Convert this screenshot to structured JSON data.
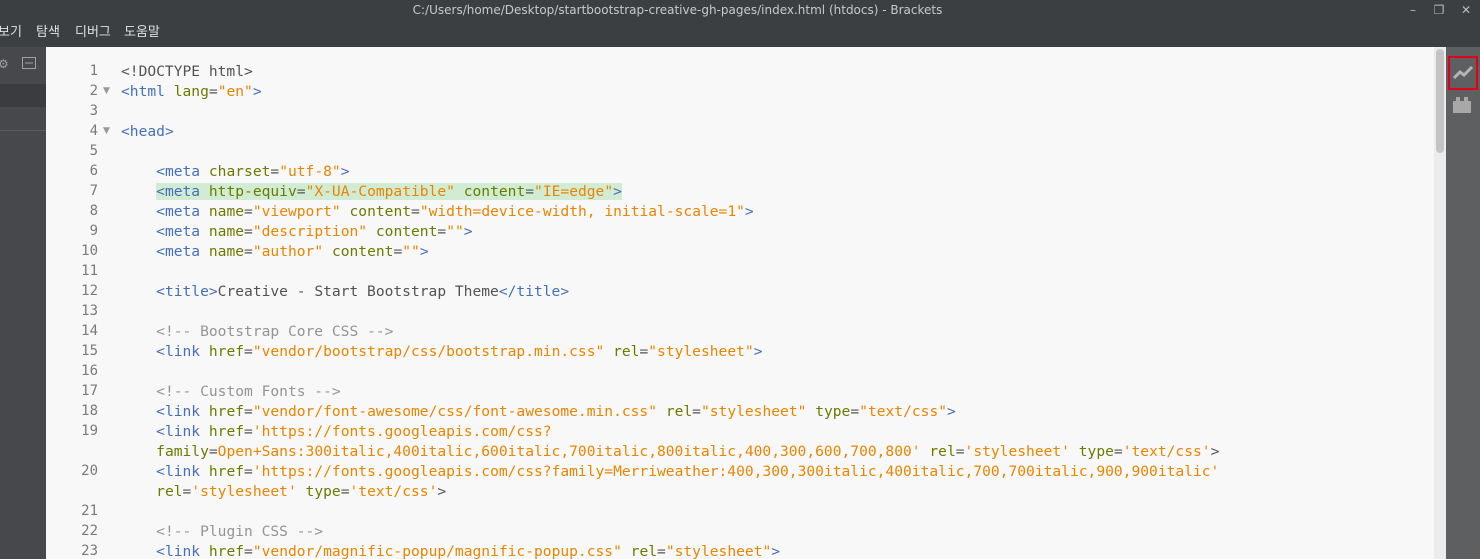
{
  "window": {
    "title": "C:/Users/home/Desktop/startbootstrap-creative-gh-pages/index.html (htdocs) - Brackets",
    "minimize_glyph": "–",
    "restore_glyph": "❐",
    "close_glyph": "✕"
  },
  "menu": {
    "items": [
      "보기",
      "탐색",
      "디버그",
      "도움말"
    ]
  },
  "sidebar": {
    "gear_icon": "gear-icon",
    "split_icon": "split-view-icon"
  },
  "toolbar": {
    "live_preview_icon": "live-preview-icon",
    "extension_icon": "extension-manager-icon"
  },
  "editor": {
    "line_numbers": [
      "1",
      "2",
      "3",
      "4",
      "5",
      "6",
      "7",
      "8",
      "9",
      "10",
      "11",
      "12",
      "13",
      "14",
      "15",
      "16",
      "17",
      "18",
      "19",
      "",
      "20",
      "",
      "21",
      "22",
      "23"
    ],
    "lines": [
      "<!DOCTYPE html>",
      "<html lang=\"en\">",
      "",
      "<head>",
      "",
      "    <meta charset=\"utf-8\">",
      "    <meta http-equiv=\"X-UA-Compatible\" content=\"IE=edge\">",
      "    <meta name=\"viewport\" content=\"width=device-width, initial-scale=1\">",
      "    <meta name=\"description\" content=\"\">",
      "    <meta name=\"author\" content=\"\">",
      "",
      "    <title>Creative - Start Bootstrap Theme</title>",
      "",
      "    <!-- Bootstrap Core CSS -->",
      "    <link href=\"vendor/bootstrap/css/bootstrap.min.css\" rel=\"stylesheet\">",
      "",
      "    <!-- Custom Fonts -->",
      "    <link href=\"vendor/font-awesome/css/font-awesome.min.css\" rel=\"stylesheet\" type=\"text/css\">",
      "    <link href='https://fonts.googleapis.com/css?",
      "    family=Open+Sans:300italic,400italic,600italic,700italic,800italic,400,300,600,700,800' rel='stylesheet' type='text/css'>",
      "    <link href='https://fonts.googleapis.com/css?family=Merriweather:400,300,300italic,400italic,700,700italic,900,900italic'",
      "    rel='stylesheet' type='text/css'>",
      "",
      "    <!-- Plugin CSS -->",
      "    <link href=\"vendor/magnific-popup/magnific-popup.css\" rel=\"stylesheet\">"
    ],
    "fold_markers": [
      "▼",
      "▼"
    ],
    "highlighted_line": "7"
  }
}
